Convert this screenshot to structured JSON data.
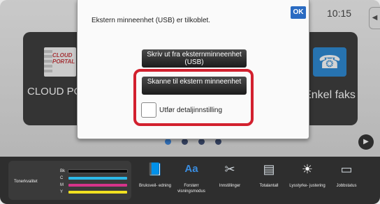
{
  "status": {
    "time": "10:15",
    "side_tab_glyph": "◀"
  },
  "home": {
    "tile_left": {
      "name": "CLOUD POR",
      "logo_text": "CLOUD PORTAL"
    },
    "tile_right": {
      "name": "Enkel faks",
      "icon": "fax-icon"
    },
    "page_dots": 4
  },
  "dialog": {
    "message": "Ekstern minneenhet (USB) er tilkoblet.",
    "ok_label": "OK",
    "print_button": "Skriv ut fra eksternminneenhet (USB)",
    "scan_button": "Skanne til ekstern minneenhet",
    "detail_checkbox_label": "Utfør detaljinnstilling",
    "detail_checked": false,
    "highlight_color": "#d2202e"
  },
  "bottom_bar": {
    "toner_label": "Tonerkvalitet",
    "toner_levels": [
      {
        "label": "Bk",
        "color": "#111111",
        "level": 1.0
      },
      {
        "label": "C",
        "color": "#2cb8e8",
        "level": 1.0
      },
      {
        "label": "M",
        "color": "#d6338a",
        "level": 1.0
      },
      {
        "label": "Y",
        "color": "#f0e020",
        "level": 1.0
      }
    ],
    "functions": [
      {
        "label": "Bruksveil- edning",
        "icon": "guide-book-icon",
        "glyph": "📘"
      },
      {
        "label": "Forstørr visningsmodus",
        "icon": "enlarge-text-icon",
        "glyph": "Aa"
      },
      {
        "label": "Innstillinger",
        "icon": "settings-tools-icon",
        "glyph": "✂"
      },
      {
        "label": "Totalantall",
        "icon": "counter-icon",
        "glyph": "▤"
      },
      {
        "label": "Lysstyrke- justering",
        "icon": "brightness-icon",
        "glyph": "☀"
      },
      {
        "label": "Jobbstatus",
        "icon": "job-status-icon",
        "glyph": "▭"
      }
    ]
  }
}
